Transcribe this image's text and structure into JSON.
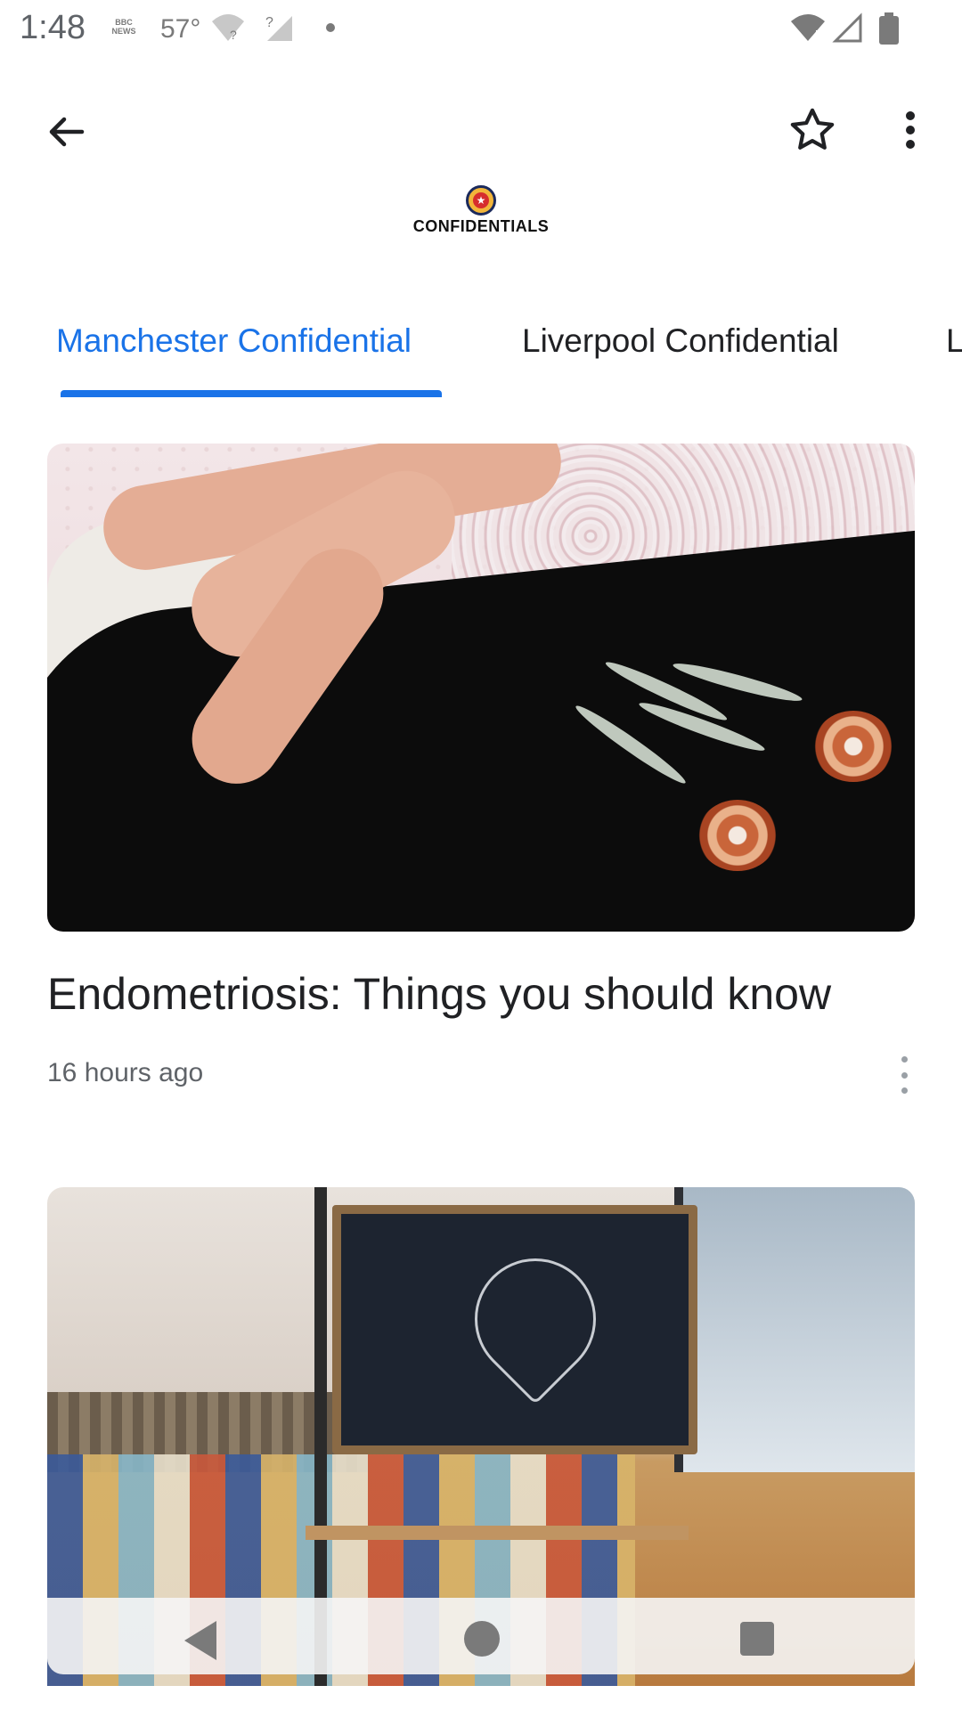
{
  "status_bar": {
    "time": "1:48",
    "news_badge": "BBC NEWS",
    "temperature": "57°"
  },
  "app_bar": {
    "back_icon": "arrow-back-icon",
    "star_icon": "star-outline-icon",
    "more_icon": "more-vert-icon"
  },
  "publication": {
    "logo_text": "CONFIDENTIALS"
  },
  "tabs": [
    {
      "label": "Manchester Confidential",
      "selected": true
    },
    {
      "label": "Liverpool Confidential",
      "selected": false
    },
    {
      "label": "L",
      "selected": false
    }
  ],
  "articles": [
    {
      "title": "Endometriosis: Things you should know",
      "time_ago": "16 hours ago"
    },
    {
      "title": "",
      "time_ago": ""
    }
  ],
  "colors": {
    "accent": "#1a73e8",
    "text_primary": "#202124",
    "text_secondary": "#5f6368"
  }
}
